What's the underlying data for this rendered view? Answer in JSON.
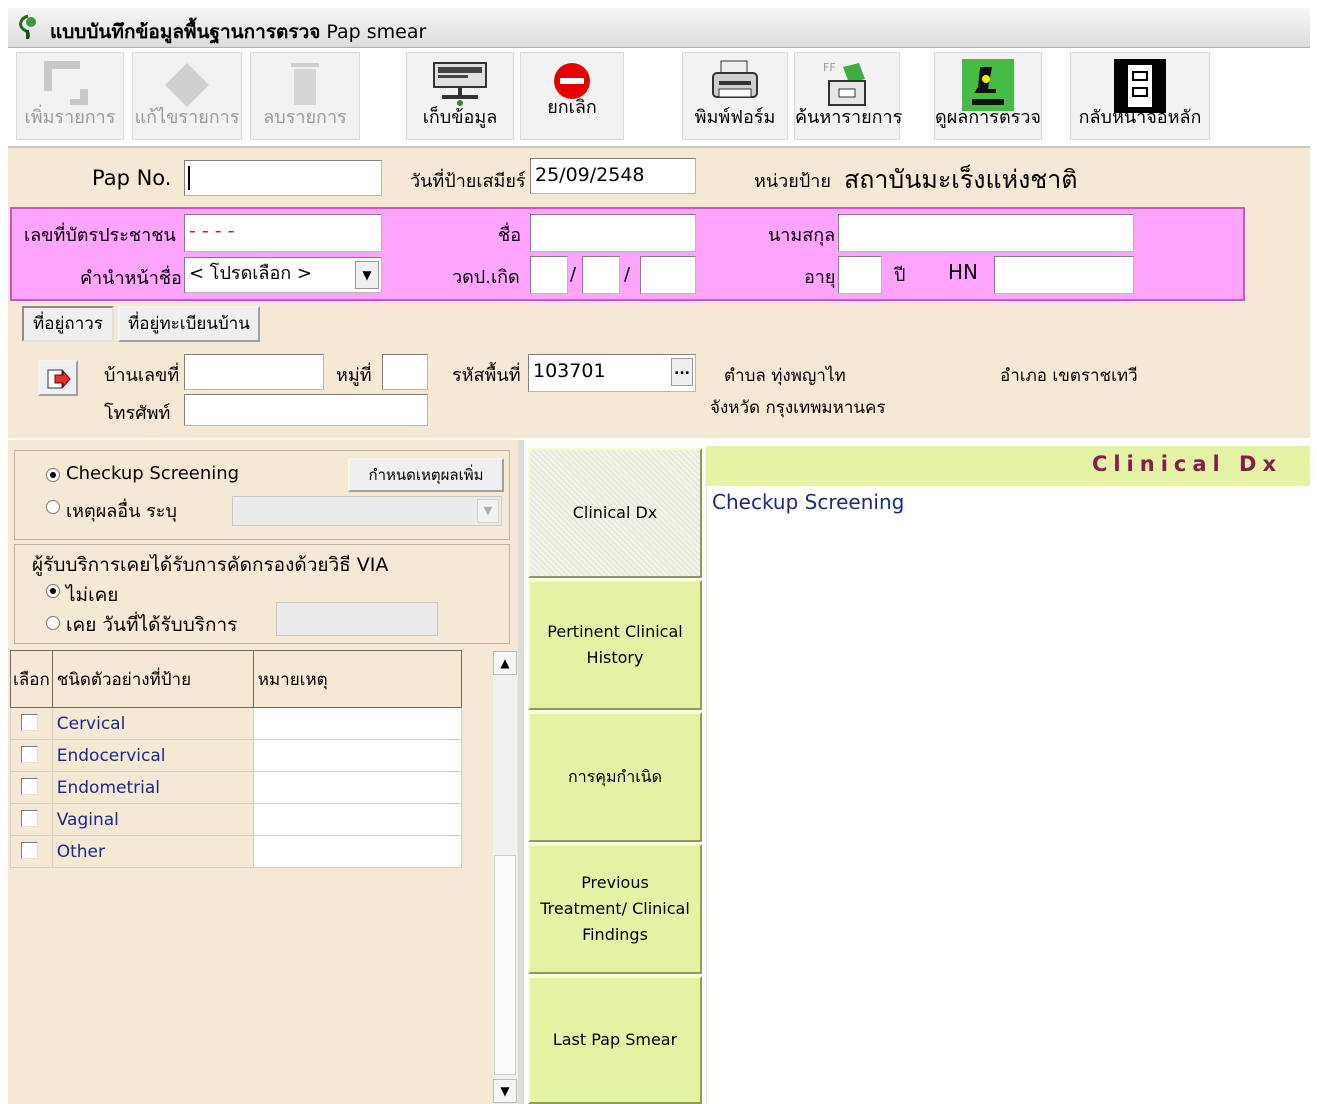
{
  "window": {
    "title_bold": "แบบบันทึกข้อมูลพื้นฐานการตรวจ",
    "title_rest": " Pap smear"
  },
  "toolbar": {
    "add_label": "เพิ่มรายการ",
    "edit_label": "แก้ไขรายการ",
    "delete_label": "ลบรายการ",
    "save_label": "เก็บข้อมูล",
    "cancel_label": "ยกเลิก",
    "print_label": "พิมพ์ฟอร์ม",
    "search_label": "ค้นหารายการ",
    "results_label": "ดูผลการตรวจ",
    "home_label": "กลับหน้าจอหลัก"
  },
  "form": {
    "pap_no_label": "Pap No.",
    "pap_no_value": "",
    "smear_date_label": "วันที่ป้ายเสมียร์",
    "smear_date_value": "25/09/2548",
    "unit_label": "หน่วยป้าย",
    "unit_value": "สถาบันมะเร็งแห่งชาติ",
    "id_card_label": "เลขที่บัตรประชาชน",
    "id_card_value": "-   -    - -",
    "firstname_label": "ชื่อ",
    "firstname_value": "",
    "lastname_label": "นามสกุล",
    "lastname_value": "",
    "prefix_label": "คำนำหน้าชื่อ",
    "prefix_value": "< โปรดเลือก >",
    "dob_label": "วดป.เกิด",
    "dob_sep1": "/",
    "dob_sep2": "/",
    "age_label": "อายุ",
    "age_unit": "ปี",
    "hn_label": "HN",
    "hn_value": ""
  },
  "address": {
    "tab_permanent": "ที่อยู่ถาวร",
    "tab_registered": "ที่อยู่ทะเบียนบ้าน",
    "house_no_label": "บ้านเลขที่",
    "moo_label": "หมู่ที่",
    "area_code_label": "รหัสพื้นที่",
    "area_code_value": "103701",
    "area_btn": "...",
    "subdistrict_label": "ตำบล ทุ่งพญาไท",
    "district_label": "อำเภอ เขตราชเทวี",
    "province_label": "จังหวัด กรุงเทพมหานคร",
    "phone_label": "โทรศัพท์"
  },
  "reason": {
    "checkup_label": "Checkup Screening",
    "other_label": "เหตุผลอื่น ระบุ",
    "define_btn": "กำหนดเหตุผลเพิ่ม"
  },
  "via": {
    "question": "ผู้รับบริการเคยได้รับการคัดกรองด้วยวิธี VIA",
    "never_label": "ไม่เคย",
    "ever_label": "เคย  วันที่ได้รับบริการ"
  },
  "specimen_table": {
    "headers": [
      "เลือก",
      "ชนิดตัวอย่างที่ป้าย",
      "หมายเหตุ"
    ],
    "rows": [
      "Cervical",
      "Endocervical",
      "Endometrial",
      "Vaginal",
      "Other"
    ]
  },
  "tabs": {
    "clinical_dx": "Clinical Dx",
    "pertinent_1": "Pertinent Clinical",
    "pertinent_2": "History",
    "birth_control": "การคุมกำเนิด",
    "prev_1": "Previous",
    "prev_2": "Treatment/ Clinical",
    "prev_3": "Findings",
    "last_pap": "Last Pap Smear"
  },
  "panel": {
    "header": "Clinical Dx",
    "content": "Checkup Screening"
  },
  "colors": {
    "form_bg": "#f5e9d4",
    "pink_box": "#ffa4ff",
    "tab_green": "#e3f3a3",
    "header_text": "#8a1a50",
    "link_blue": "#1a2a8a"
  }
}
